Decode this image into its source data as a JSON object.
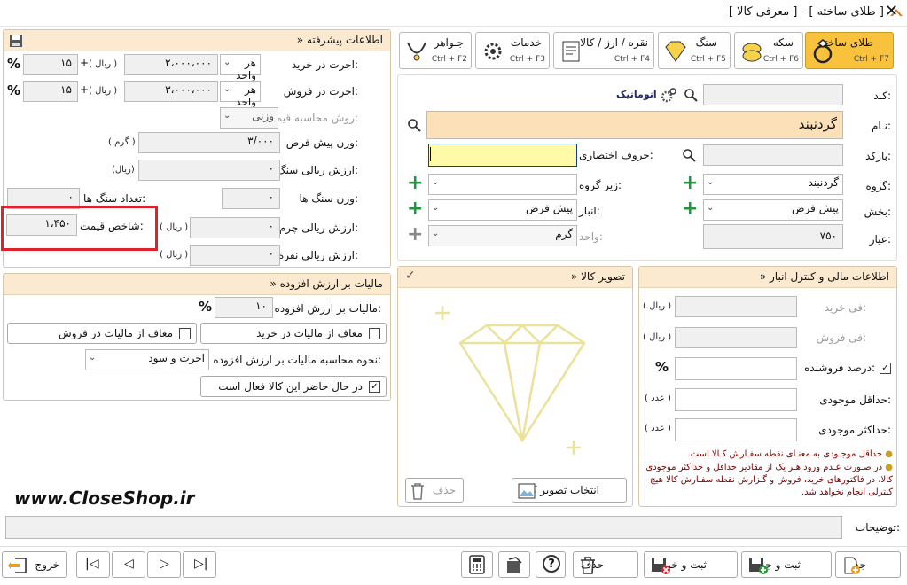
{
  "window": {
    "title": "[ معرفی کالا ] - [ طلای ساخته ]"
  },
  "advanced": {
    "header": "» اطلاعات پیشرفته",
    "wage_buy_label": "اجرت در خرید:",
    "wage_buy_mode": "هر واحد",
    "wage_buy_value": "۲،۰۰۰،۰۰۰",
    "wage_buy_unit": "( ریال )",
    "wage_buy_pct": "۱۵",
    "wage_sell_label": "اجرت در فروش:",
    "wage_sell_mode": "هر واحد",
    "wage_sell_value": "۳،۰۰۰،۰۰۰",
    "wage_sell_unit": "( ریال )",
    "wage_sell_pct": "۱۵",
    "plus_sign": "+",
    "pct_sign": "%",
    "calc_method_label": "روش محاسبه قیمت:",
    "calc_method_value": "وزنی",
    "default_weight_label": "وزن پیش فرض:",
    "default_weight_value": "۳/۰۰۰",
    "default_weight_unit": "( گرم )",
    "stone_rial_label": "ارزش ریالی سنگ ها:",
    "stone_rial_value": "۰",
    "stone_rial_unit": "(ریال)",
    "stone_weight_label": "وزن سنگ ها:",
    "stone_weight_value": "۰",
    "stone_count_label": "تعداد سنگ ها:",
    "stone_count_value": "۰",
    "leather_label": "ارزش ریالی چرم:",
    "leather_value": "۰",
    "leather_unit": "( ریال )",
    "price_index_label": "شاخص قیمت:",
    "price_index_value": "۱،۴۵۰",
    "silver_label": "ارزش ریالی نقره:",
    "silver_value": "۰",
    "silver_unit": "( ریال )"
  },
  "vat": {
    "header": "» مالیات بر ارزش افزوده",
    "vat_label": "مالیات بر ارزش افزوده:",
    "vat_value": "۱۰",
    "pct_sign": "%",
    "exempt_buy": "معاف از مالیات در خرید",
    "exempt_sell": "معاف از مالیات در فروش",
    "method_label": "نحوه محاسبه مالیات بر ارزش افزوده:",
    "method_value": "اجرت و سود",
    "active_label": "در حال حاضر این کالا فعال است"
  },
  "tabs": [
    {
      "label": "طلای ساخته",
      "shortcut": "Ctrl + F7"
    },
    {
      "label": "سکه",
      "shortcut": "Ctrl + F6"
    },
    {
      "label": "سنگ",
      "shortcut": "Ctrl + F5"
    },
    {
      "label": "نقره / ارز / کالا",
      "shortcut": "Ctrl + F4"
    },
    {
      "label": "خدمات",
      "shortcut": "Ctrl + F3"
    },
    {
      "label": "جـواهر",
      "shortcut": "Ctrl + F2"
    }
  ],
  "main": {
    "code_label": "کـد:",
    "auto_label": "اتوماتیک",
    "name_label": "نـام:",
    "name_value": "گردنبند",
    "barcode_label": "بارکد:",
    "shortcut_label": "حروف اختصاری:",
    "group_label": "گروه:",
    "group_value": "گردنبند",
    "subgroup_label": "زیر گروه:",
    "section_label": "بخش:",
    "section_value": "پیش فرض",
    "warehouse_label": "انبار:",
    "warehouse_value": "پیش فرض",
    "karat_label": "عیار:",
    "karat_value": "۷۵۰",
    "unit_label": "واحد:",
    "unit_value": "گرم"
  },
  "image_panel": {
    "header": "» تصویر کالا",
    "select_btn": "انتخاب تصویر کالا",
    "delete_btn": "حذف",
    "watermark": "www.CloseShop.ir"
  },
  "finance": {
    "header": "» اطلاعات مالی و کنترل انبار",
    "buy_price_label": "فی خرید:",
    "buy_price_unit": "( ریال )",
    "sell_price_label": "فی فروش:",
    "sell_price_unit": "( ریال )",
    "seller_pct_label": "درصد فروشنده:",
    "pct_sign": "%",
    "min_stock_label": "حداقل موجودی:",
    "min_stock_unit": "( عدد )",
    "max_stock_label": "حداکثر موجودی:",
    "max_stock_unit": "( عدد )",
    "note1": "حداقل موجـودی به معنـای نقطه سفـارش کـالا است.",
    "note2": "در صـورت عـدم ورود هـر یک از مقادیر حداقل و حداکثر موجودی کالا، در فاکتورهای خرید، فروش و گـزارش نقطه سفـارش کالا هیچ کنترلی انجام نخواهد شد."
  },
  "desc_label": "توضیحات:",
  "footer": {
    "new": "جدید",
    "save_new": "ثبت و جدید",
    "save_exit": "ثبت و خروج",
    "delete": "حذف",
    "help": "?",
    "exit": "خروج"
  }
}
